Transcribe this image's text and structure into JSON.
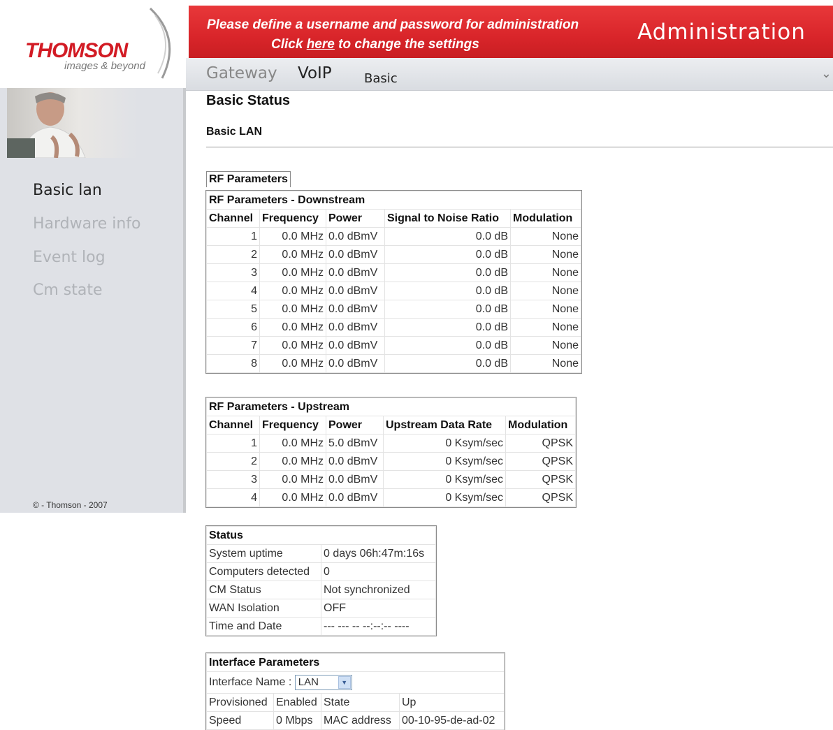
{
  "logo": {
    "brand": "THOMSON",
    "tagline": "images & beyond",
    "brand_color": "#d21b24"
  },
  "banner": {
    "line1": "Please define a username and password for administration",
    "line2_prefix": "Click ",
    "line2_link": "here",
    "line2_suffix": " to change the settings",
    "right_title": "Administration",
    "color": "#d9252a"
  },
  "tabs": {
    "gateway": "Gateway",
    "voip": "VoIP",
    "basic": "Basic",
    "chevron": "⌄"
  },
  "sidebar": {
    "items": [
      {
        "label": "Basic lan",
        "active": true
      },
      {
        "label": "Hardware info",
        "active": false
      },
      {
        "label": "Event log",
        "active": false
      },
      {
        "label": "Cm state",
        "active": false
      }
    ],
    "copyright": "© - Thomson - 2007",
    "photo_icon": "person-laptop-photo"
  },
  "main": {
    "title": "Basic Status",
    "section": "Basic LAN",
    "rf_tab": "RF Parameters"
  },
  "downstream": {
    "caption": "RF Parameters - Downstream",
    "headers": [
      "Channel",
      "Frequency",
      "Power",
      "Signal to Noise Ratio",
      "Modulation"
    ],
    "rows": [
      [
        "1",
        "0.0 MHz",
        "0.0 dBmV",
        "0.0 dB",
        "None"
      ],
      [
        "2",
        "0.0 MHz",
        "0.0 dBmV",
        "0.0 dB",
        "None"
      ],
      [
        "3",
        "0.0 MHz",
        "0.0 dBmV",
        "0.0 dB",
        "None"
      ],
      [
        "4",
        "0.0 MHz",
        "0.0 dBmV",
        "0.0 dB",
        "None"
      ],
      [
        "5",
        "0.0 MHz",
        "0.0 dBmV",
        "0.0 dB",
        "None"
      ],
      [
        "6",
        "0.0 MHz",
        "0.0 dBmV",
        "0.0 dB",
        "None"
      ],
      [
        "7",
        "0.0 MHz",
        "0.0 dBmV",
        "0.0 dB",
        "None"
      ],
      [
        "8",
        "0.0 MHz",
        "0.0 dBmV",
        "0.0 dB",
        "None"
      ]
    ]
  },
  "upstream": {
    "caption": "RF Parameters - Upstream",
    "headers": [
      "Channel",
      "Frequency",
      "Power",
      "Upstream Data Rate",
      "Modulation"
    ],
    "rows": [
      [
        "1",
        "0.0 MHz",
        "5.0 dBmV",
        "0 Ksym/sec",
        "QPSK"
      ],
      [
        "2",
        "0.0 MHz",
        "0.0 dBmV",
        "0 Ksym/sec",
        "QPSK"
      ],
      [
        "3",
        "0.0 MHz",
        "0.0 dBmV",
        "0 Ksym/sec",
        "QPSK"
      ],
      [
        "4",
        "0.0 MHz",
        "0.0 dBmV",
        "0 Ksym/sec",
        "QPSK"
      ]
    ]
  },
  "status": {
    "caption": "Status",
    "rows": [
      [
        "System uptime",
        "0 days 06h:47m:16s"
      ],
      [
        "Computers detected",
        "0"
      ],
      [
        "CM Status",
        "Not synchronized"
      ],
      [
        "WAN Isolation",
        "OFF"
      ],
      [
        "Time and Date",
        "--- --- -- --:--:-- ----"
      ]
    ]
  },
  "interface": {
    "caption": "Interface Parameters",
    "name_label": "Interface Name :",
    "name_value": "LAN",
    "row2": [
      "Provisioned",
      "Enabled",
      "State",
      "Up"
    ],
    "row3": [
      "Speed",
      "0 Mbps",
      "MAC address",
      "00-10-95-de-ad-02"
    ]
  }
}
